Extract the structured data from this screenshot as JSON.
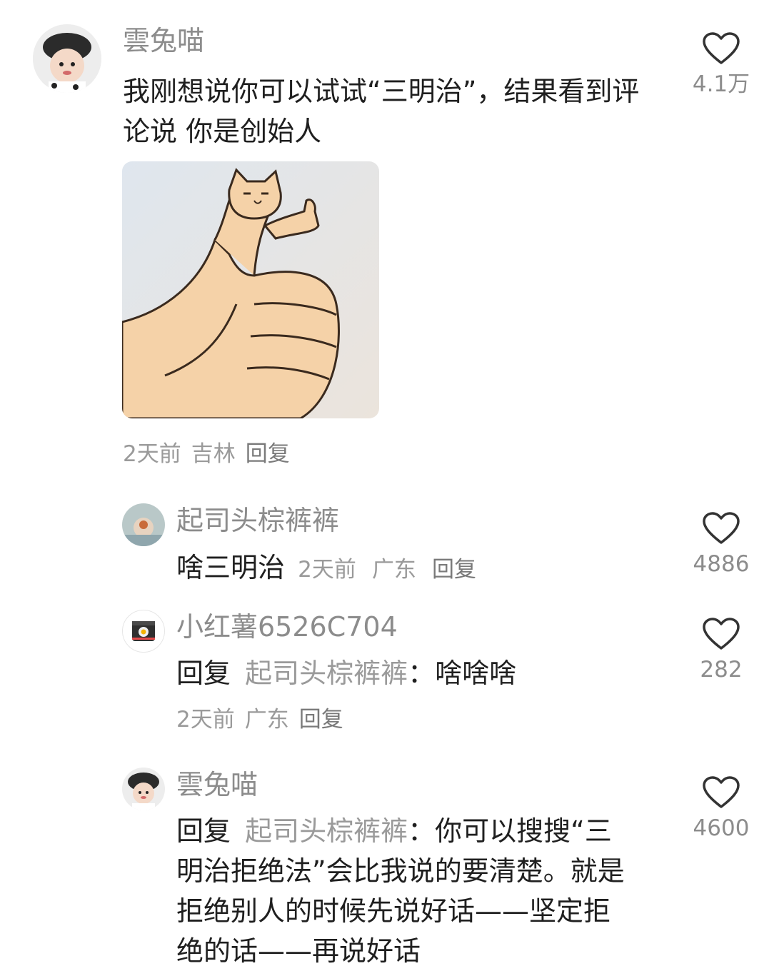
{
  "comment": {
    "username": "雲兔喵",
    "text": "我刚想说你可以试试“三明治”，结果看到评论说 你是创始人",
    "image_alt": "cat thumbs-up meme",
    "time": "2天前",
    "location": "吉林",
    "reply_label": "回复",
    "likes": "4.1万"
  },
  "replies": [
    {
      "username": "起司头棕裤裤",
      "text": "啥三明治",
      "time": "2天前",
      "location": "广东",
      "reply_label": "回复",
      "likes": "4886"
    },
    {
      "username": "小红薯6526C704",
      "reply_prefix": "回复",
      "reply_to": "起司头棕裤裤",
      "colon": "：",
      "text": "啥啥啥",
      "time": "2天前",
      "location": "广东",
      "reply_label": "回复",
      "likes": "282"
    },
    {
      "username": "雲兔喵",
      "reply_prefix": "回复",
      "reply_to": "起司头棕裤裤",
      "colon": "：",
      "text": "你可以搜搜“三明治拒绝法”会比我说的要清楚。就是拒绝别人的时候先说好话——坚定拒绝的话——再说好话",
      "likes": "4600"
    }
  ],
  "icons": {
    "like": "heart-outline-icon",
    "avatar_app": "camera-icon"
  },
  "colors": {
    "username": "#8c8c8c",
    "body": "#1f1f1f",
    "meta": "#9a9a9a",
    "heart": "#333333"
  }
}
